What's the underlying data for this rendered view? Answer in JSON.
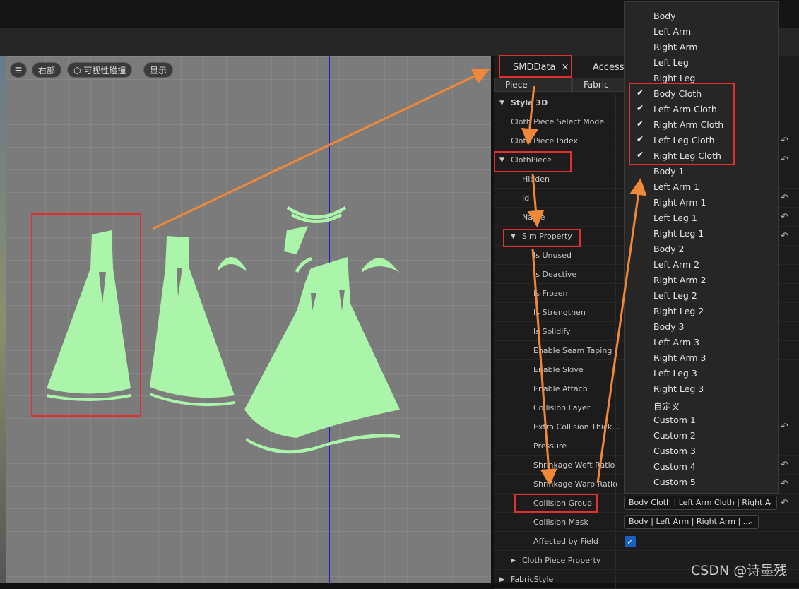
{
  "viewport": {
    "buttons": [
      "右部",
      "可视性碰撞",
      "显示"
    ],
    "menu_icon": "hamburger-icon",
    "visibility_icon": "cube-icon",
    "piece_color": "#aaf5aa",
    "accent_axis_colors": {
      "x": "#c81010",
      "y": "#1a1ad0"
    }
  },
  "panel": {
    "tabs": {
      "smd": "SMDData",
      "close": "×",
      "access": "Access",
      "piece": "Piece",
      "fabric": "Fabric"
    },
    "rows": [
      {
        "label": "Style 3D",
        "indent": 0,
        "arrow": "▼",
        "bold": true
      },
      {
        "label": "Cloth Piece Select Mode",
        "indent": 0
      },
      {
        "label": "Cloth Piece Index",
        "indent": 0,
        "reset": true
      },
      {
        "label": "ClothPiece",
        "indent": 0,
        "arrow": "▼",
        "reset": true
      },
      {
        "label": "Hidden",
        "indent": 1
      },
      {
        "label": "Id",
        "indent": 1,
        "reset": true
      },
      {
        "label": "Name",
        "indent": 1,
        "reset": true
      },
      {
        "label": "Sim Property",
        "indent": 1,
        "arrow": "▼",
        "reset": true
      },
      {
        "label": "Is Unused",
        "indent": 2
      },
      {
        "label": "Is Deactive",
        "indent": 2
      },
      {
        "label": "Is Frozen",
        "indent": 2
      },
      {
        "label": "Is Strengthen",
        "indent": 2
      },
      {
        "label": "Is Solidify",
        "indent": 2
      },
      {
        "label": "Enable Seam Taping",
        "indent": 2
      },
      {
        "label": "Enable Skive",
        "indent": 2
      },
      {
        "label": "Enable Attach",
        "indent": 2
      },
      {
        "label": "Collision Layer",
        "indent": 2
      },
      {
        "label": "Extra Collision Thick…",
        "indent": 2,
        "reset": true
      },
      {
        "label": "Pressure",
        "indent": 2
      },
      {
        "label": "Shrinkage Weft Ratio",
        "indent": 2,
        "reset": true
      },
      {
        "label": "Shrinkage Warp Ratio",
        "indent": 2,
        "reset": true
      },
      {
        "label": "Collision Group",
        "indent": 2,
        "reset": true
      },
      {
        "label": "Collision Mask",
        "indent": 2
      },
      {
        "label": "Affected by Field",
        "indent": 2
      },
      {
        "label": "Cloth Piece Property",
        "indent": 1,
        "arrow": "▶"
      },
      {
        "label": "FabricStyle",
        "indent": 0,
        "arrow": "▶"
      }
    ],
    "collision_group_value": "Body Cloth | Left Arm Cloth | Right A",
    "collision_mask_value": "Body | Left Arm | Right Arm | ...",
    "affected_by_field": true
  },
  "dropdown": {
    "items": [
      {
        "label": "Body",
        "checked": false
      },
      {
        "label": "Left Arm",
        "checked": false
      },
      {
        "label": "Right Arm",
        "checked": false
      },
      {
        "label": "Left Leg",
        "checked": false
      },
      {
        "label": "Right Leg",
        "checked": false
      },
      {
        "label": "Body Cloth",
        "checked": true
      },
      {
        "label": "Left Arm Cloth",
        "checked": true
      },
      {
        "label": "Right Arm Cloth",
        "checked": true
      },
      {
        "label": "Left Leg Cloth",
        "checked": true
      },
      {
        "label": "Right Leg Cloth",
        "checked": true
      },
      {
        "label": "Body 1",
        "checked": false
      },
      {
        "label": "Left Arm 1",
        "checked": false
      },
      {
        "label": "Right Arm 1",
        "checked": false
      },
      {
        "label": "Left Leg 1",
        "checked": false
      },
      {
        "label": "Right Leg 1",
        "checked": false
      },
      {
        "label": "Body 2",
        "checked": false
      },
      {
        "label": "Left Arm 2",
        "checked": false
      },
      {
        "label": "Right Arm 2",
        "checked": false
      },
      {
        "label": "Left Leg 2",
        "checked": false
      },
      {
        "label": "Right Leg 2",
        "checked": false
      },
      {
        "label": "Body 3",
        "checked": false
      },
      {
        "label": "Left Arm 3",
        "checked": false
      },
      {
        "label": "Right Arm 3",
        "checked": false
      },
      {
        "label": "Left Leg 3",
        "checked": false
      },
      {
        "label": "Right Leg 3",
        "checked": false
      },
      {
        "label": "自定义",
        "checked": false
      },
      {
        "label": "Custom 1",
        "checked": false
      },
      {
        "label": "Custom 2",
        "checked": false
      },
      {
        "label": "Custom 3",
        "checked": false
      },
      {
        "label": "Custom 4",
        "checked": false
      },
      {
        "label": "Custom 5",
        "checked": false
      }
    ]
  },
  "watermark": "CSDN @诗墨残",
  "annotation_color": "#f0883a",
  "highlight_color": "#e03030"
}
